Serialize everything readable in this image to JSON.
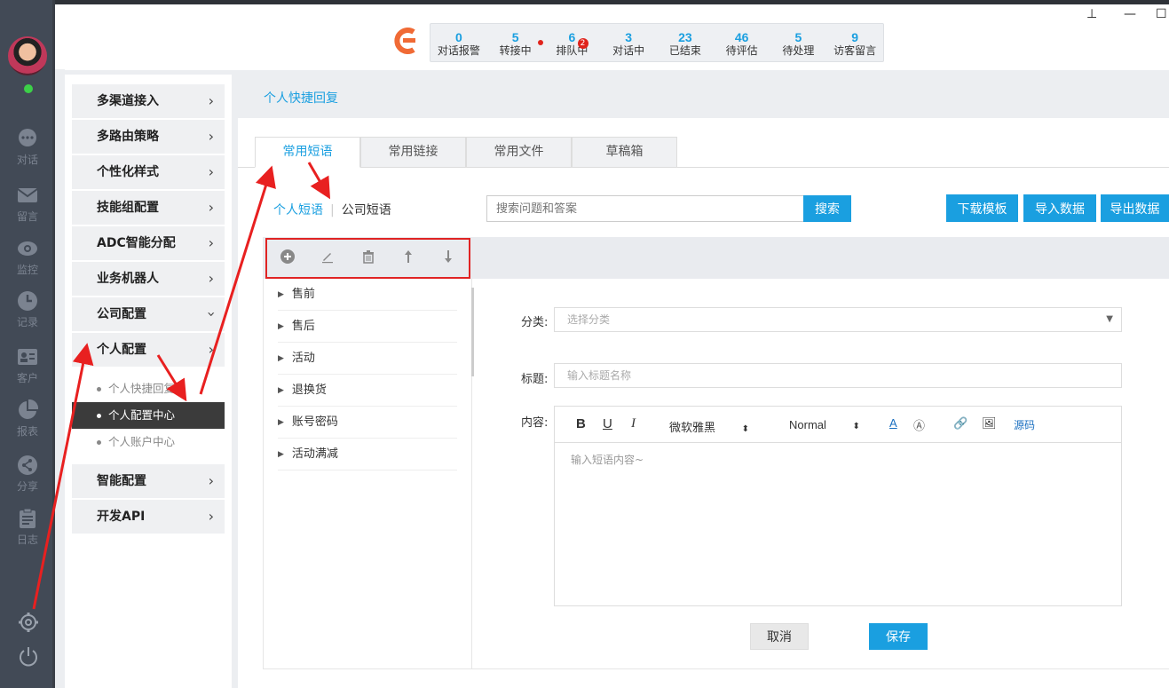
{
  "rail": {
    "items": [
      {
        "label": "对话",
        "icon": "chat-icon"
      },
      {
        "label": "留言",
        "icon": "mail-icon"
      },
      {
        "label": "监控",
        "icon": "eye-icon"
      },
      {
        "label": "记录",
        "icon": "clock-icon"
      },
      {
        "label": "客户",
        "icon": "contact-card-icon"
      },
      {
        "label": "报表",
        "icon": "pie-chart-icon"
      },
      {
        "label": "分享",
        "icon": "share-icon"
      },
      {
        "label": "日志",
        "icon": "clipboard-icon"
      }
    ],
    "status": "online"
  },
  "window": {
    "pin": "⊥",
    "minimize": "—",
    "maximize": "☐"
  },
  "stats": [
    {
      "num": "0",
      "label": "对话报警"
    },
    {
      "num": "5",
      "label": "转接中"
    },
    {
      "num": "6",
      "label": "排队中",
      "badge": "2"
    },
    {
      "num": "3",
      "label": "对话中"
    },
    {
      "num": "23",
      "label": "已结束"
    },
    {
      "num": "46",
      "label": "待评估"
    },
    {
      "num": "5",
      "label": "待处理"
    },
    {
      "num": "9",
      "label": "访客留言"
    }
  ],
  "menu": {
    "groups_top": [
      "多渠道接入",
      "多路由策略",
      "个性化样式",
      "技能组配置",
      "ADC智能分配",
      "业务机器人",
      "公司配置",
      "个人配置"
    ],
    "subitems": [
      "个人快捷回复",
      "个人配置中心",
      "个人账户中心"
    ],
    "groups_bottom": [
      "智能配置",
      "开发API"
    ]
  },
  "breadcrumb": "个人快捷回复",
  "tabs": [
    "常用短语",
    "常用链接",
    "常用文件",
    "草稿箱"
  ],
  "subtabs": {
    "personal": "个人短语",
    "company": "公司短语"
  },
  "search": {
    "placeholder": "搜索问题和答案",
    "button": "搜索"
  },
  "actions": {
    "download": "下载模板",
    "import": "导入数据",
    "export": "导出数据"
  },
  "tree": [
    "售前",
    "售后",
    "活动",
    "退换货",
    "账号密码",
    "活动满减"
  ],
  "form": {
    "category_label": "分类:",
    "category_placeholder": "选择分类",
    "title_label": "标题:",
    "title_placeholder": "输入标题名称",
    "content_label": "内容:",
    "font_name": "微软雅黑",
    "font_size": "Normal",
    "source_label": "源码",
    "content_placeholder": "输入短语内容~",
    "cancel": "取消",
    "save": "保存"
  }
}
